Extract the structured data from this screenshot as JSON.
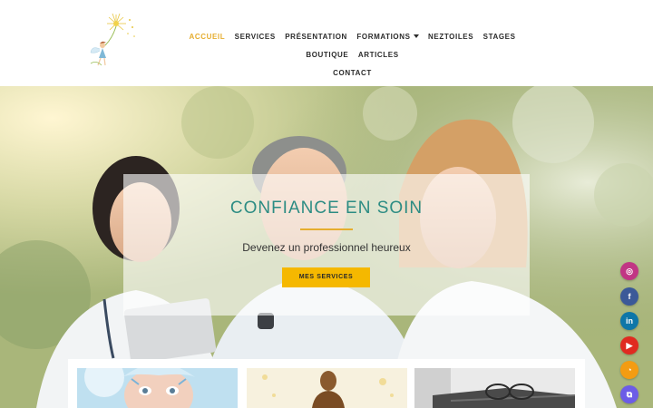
{
  "header": {
    "logo_icon": "dandelion-fairy-logo",
    "nav": [
      {
        "label": "ACCUEIL",
        "active": true
      },
      {
        "label": "SERVICES"
      },
      {
        "label": "PRÉSENTATION"
      },
      {
        "label": "FORMATIONS",
        "has_dropdown": true
      },
      {
        "label": "NEZTOILES"
      },
      {
        "label": "STAGES"
      },
      {
        "label": "BOUTIQUE"
      },
      {
        "label": "ARTICLES"
      },
      {
        "label": "CONTACT"
      }
    ]
  },
  "hero": {
    "title": "CONFIANCE EN SOIN",
    "subtitle": "Devenez un professionnel heureux",
    "button_label": "MES SERVICES"
  },
  "cards": [
    {
      "image": "face-paint-woman-photo"
    },
    {
      "image": "meditation-silhouette-photo"
    },
    {
      "image": "glasses-on-books-photo"
    }
  ],
  "social": [
    {
      "name": "instagram-icon",
      "glyph": "◎",
      "color": "#c13584"
    },
    {
      "name": "facebook-icon",
      "glyph": "f",
      "color": "#3b5998"
    },
    {
      "name": "linkedin-icon",
      "glyph": "in",
      "color": "#0e76a8"
    },
    {
      "name": "youtube-icon",
      "glyph": "▶",
      "color": "#e02a20"
    },
    {
      "name": "rss-icon",
      "glyph": "◔",
      "color": "#f39c12"
    },
    {
      "name": "share-icon",
      "glyph": "⧉",
      "color": "#6c5ce7"
    }
  ],
  "colors": {
    "accent": "#e6ad2e",
    "title": "#2c8c83",
    "button": "#f5b800"
  }
}
